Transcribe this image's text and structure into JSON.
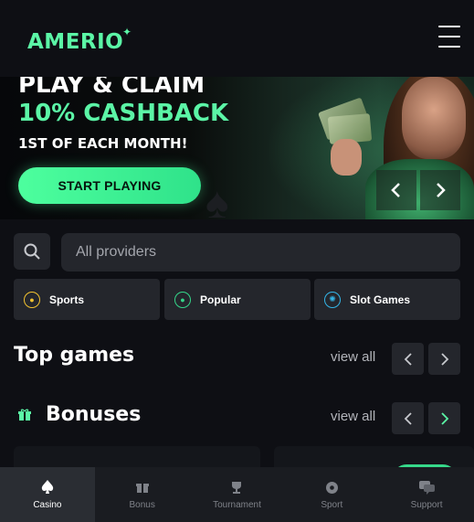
{
  "header": {
    "logo": "AMERIO",
    "menu_icon": "hamburger-icon"
  },
  "banner": {
    "line1": "PLAY & CLAIM",
    "line2": "10% CASHBACK",
    "line3": "1ST OF EACH MONTH!",
    "cta_label": "START PLAYING"
  },
  "search": {
    "icon": "search-icon",
    "providers_label": "All providers"
  },
  "categories": [
    {
      "label": "Sports",
      "icon": "soccer-ball-icon",
      "color": "#f2c230"
    },
    {
      "label": "Popular",
      "icon": "popular-user-icon",
      "color": "#35d68a"
    },
    {
      "label": "Slot Games",
      "icon": "slots-icon",
      "color": "#34b6e8"
    }
  ],
  "sections": {
    "top_games": {
      "title": "Top games",
      "view_all": "view all"
    },
    "bonuses": {
      "title": "Bonuses",
      "view_all": "view all"
    }
  },
  "bottom_nav": [
    {
      "label": "Casino",
      "icon": "spade-icon",
      "active": true
    },
    {
      "label": "Bonus",
      "icon": "gift-icon",
      "active": false
    },
    {
      "label": "Tournament",
      "icon": "trophy-icon",
      "active": false
    },
    {
      "label": "Sport",
      "icon": "ball-icon",
      "active": false
    },
    {
      "label": "Support",
      "icon": "chat-icon",
      "active": false
    }
  ],
  "colors": {
    "accent": "#5bf5a6",
    "background": "#0e0f14",
    "surface": "#24262c"
  }
}
